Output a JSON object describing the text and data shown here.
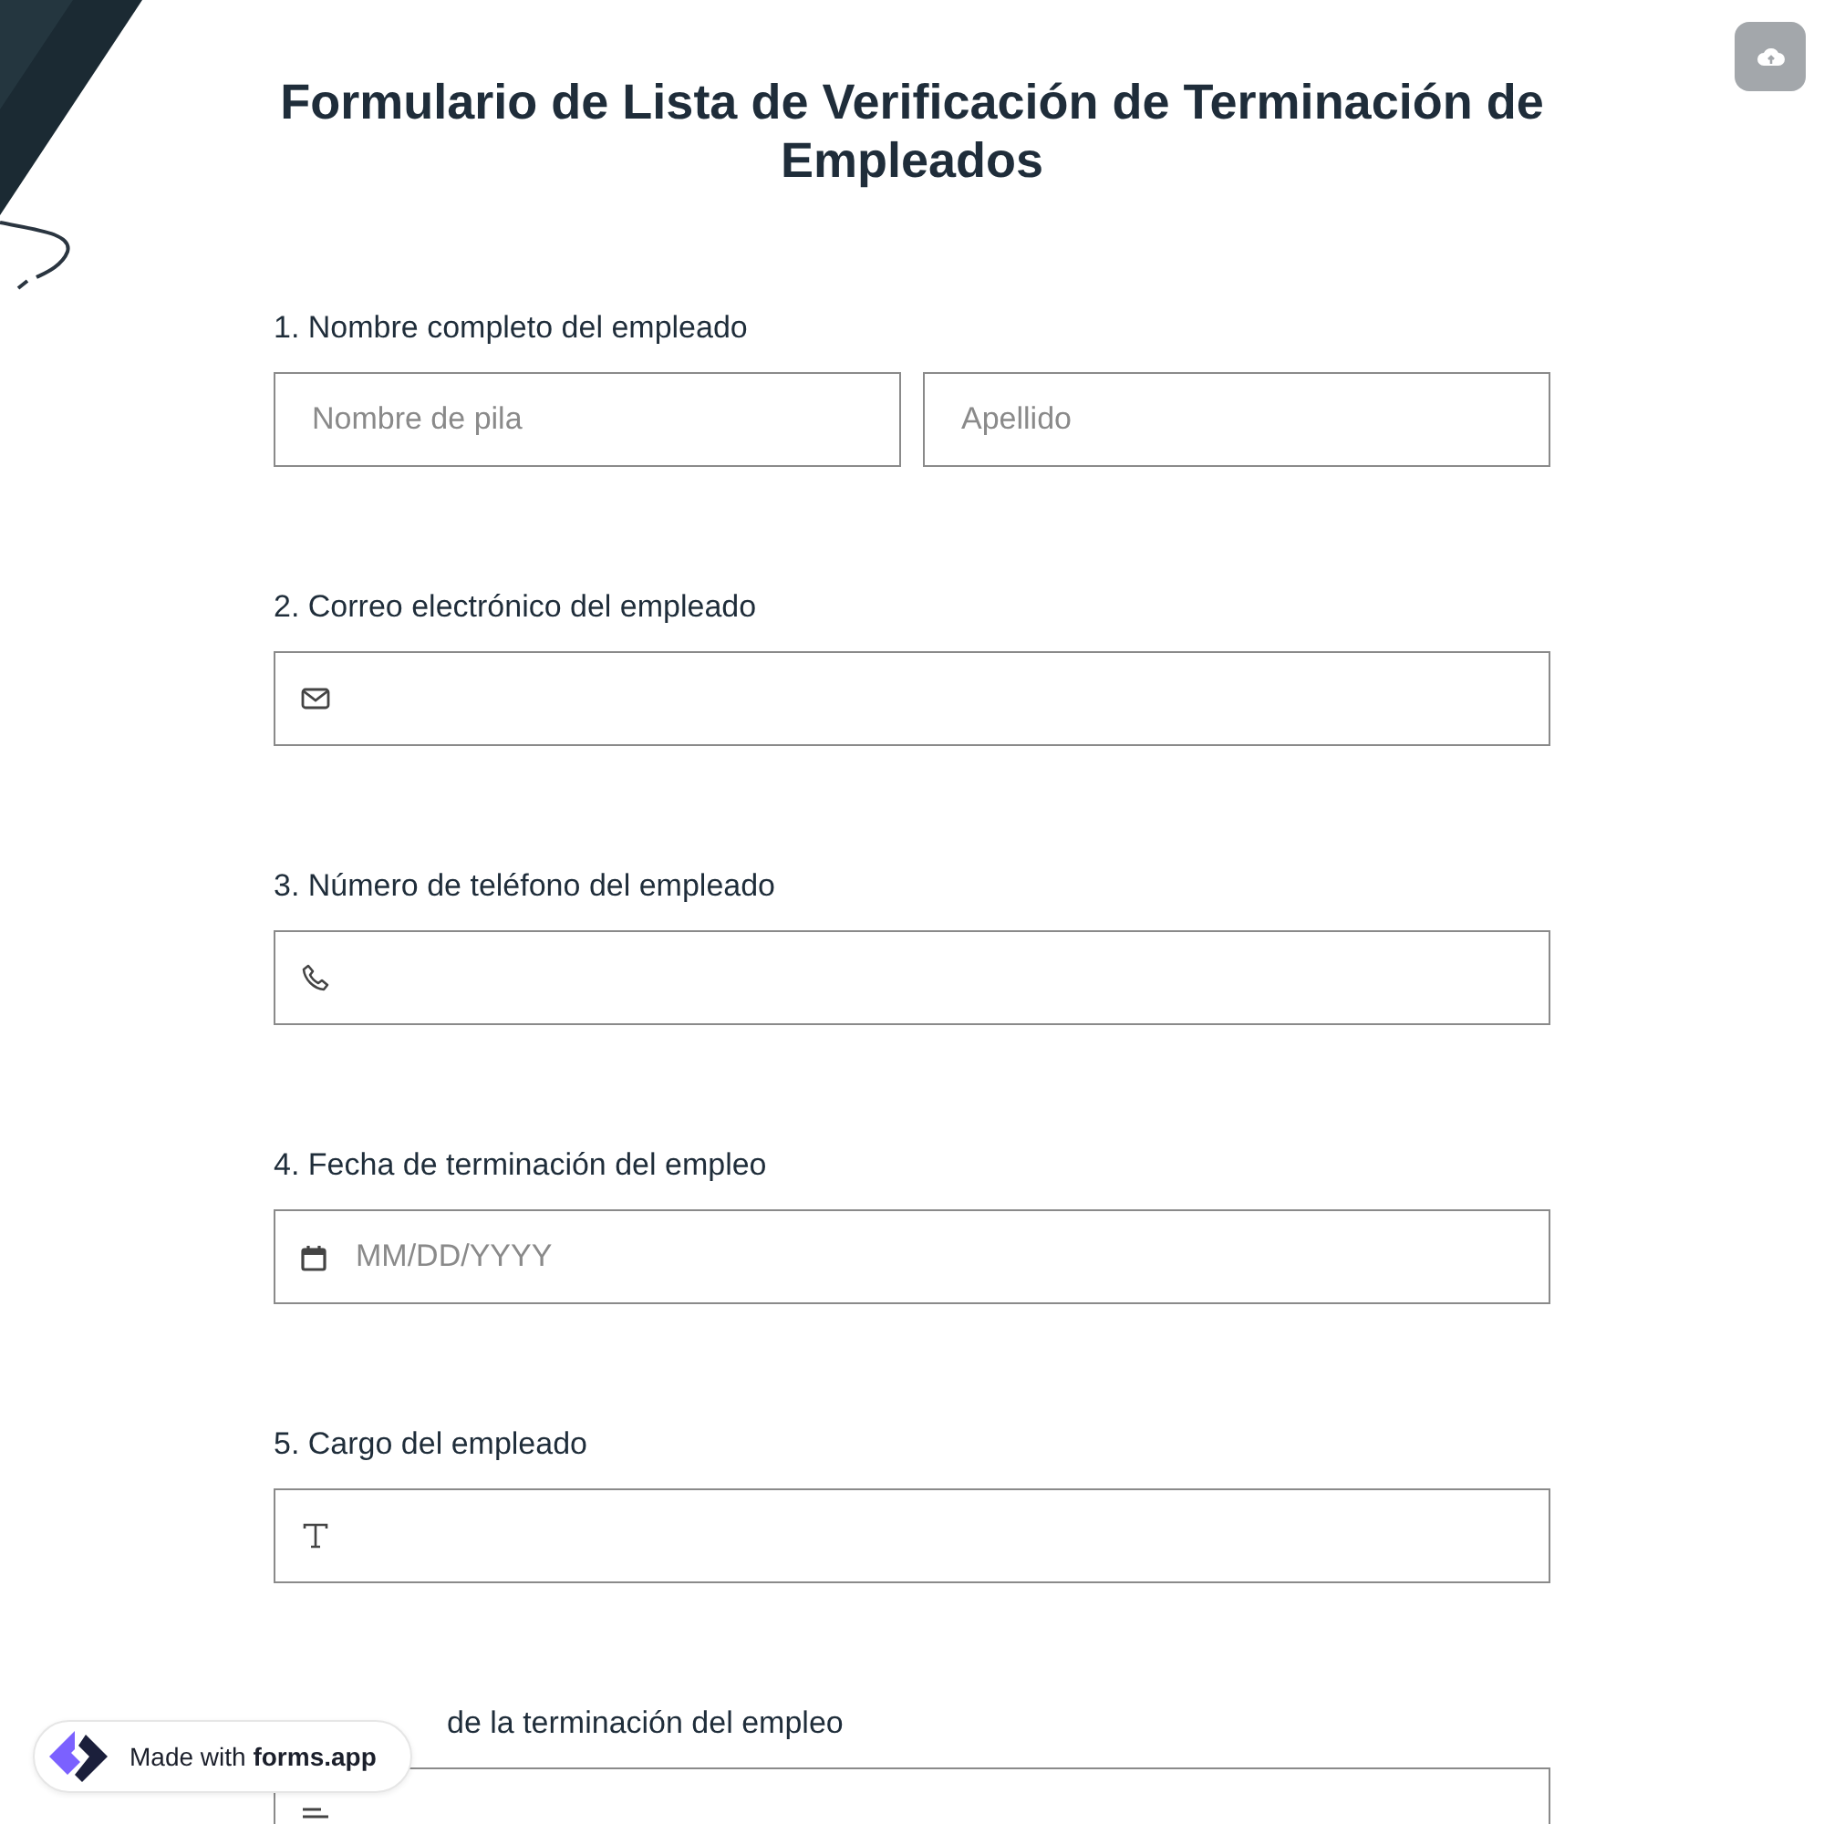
{
  "title": "Formulario de Lista de Verificación de Terminación de Empleados",
  "questions": [
    {
      "label": "1.  Nombre completo del empleado",
      "kind": "name",
      "inputs": [
        {
          "placeholder": "Nombre de pila"
        },
        {
          "placeholder": "Apellido"
        }
      ]
    },
    {
      "label": "2. Correo electrónico del empleado",
      "kind": "email"
    },
    {
      "label": "3. Número de teléfono del empleado",
      "kind": "phone"
    },
    {
      "label": "4. Fecha de terminación del empleo",
      "kind": "date",
      "placeholder": "MM/DD/YYYY"
    },
    {
      "label": "5. Cargo del empleado",
      "kind": "text"
    },
    {
      "label": "de la terminación del empleo",
      "kind": "textarea"
    }
  ],
  "badge": {
    "prefix": "Made with",
    "brand": "forms.app"
  }
}
